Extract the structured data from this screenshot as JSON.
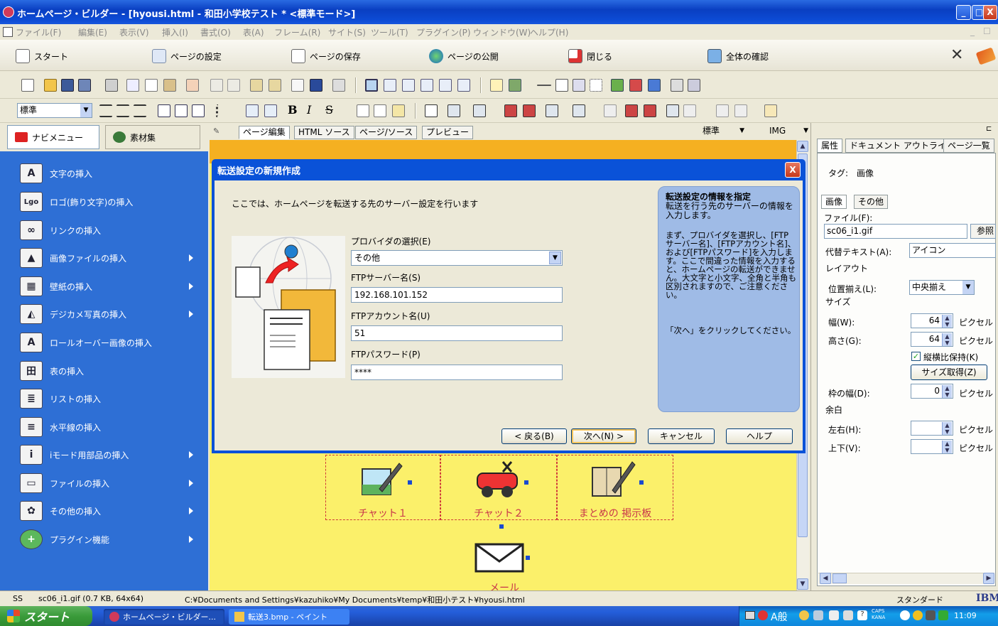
{
  "window": {
    "title": "ホームページ・ビルダー - [hyousi.html - 和田小学校テスト * <標準モード>]",
    "btn_min": "_",
    "btn_max": "□",
    "btn_close": "X"
  },
  "menu": {
    "items": [
      "ファイル(F)",
      "編集(E)",
      "表示(V)",
      "挿入(I)",
      "書式(O)",
      "表(A)",
      "フレーム(R)",
      "サイト(S)",
      "ツール(T)",
      "プラグイン(P)",
      "ウィンドウ(W)",
      "ヘルプ(H)"
    ],
    "mdi_min": "_",
    "mdi_restore": "☐"
  },
  "main_toolbar": {
    "start": "スタート",
    "page_settings": "ページの設定",
    "save_page": "ページの保存",
    "publish_page": "ページの公開",
    "close": "閉じる",
    "check_all": "全体の確認"
  },
  "format_toolbar": {
    "style_value": "標準",
    "bold": "B",
    "italic": "I",
    "strike": "S"
  },
  "nav": {
    "tab_navmenu": "ナビメニュー",
    "tab_materials": "素材集",
    "items": [
      {
        "label": "文字の挿入",
        "icon": "A"
      },
      {
        "label": "ロゴ(飾り文字)の挿入",
        "icon": "Lgo"
      },
      {
        "label": "リンクの挿入",
        "icon": "∞"
      },
      {
        "label": "画像ファイルの挿入",
        "icon": "▲"
      },
      {
        "label": "壁紙の挿入",
        "icon": "▦"
      },
      {
        "label": "デジカメ写真の挿入",
        "icon": "◭"
      },
      {
        "label": "ロールオーバー画像の挿入",
        "icon": "A"
      },
      {
        "label": "表の挿入",
        "icon": "田"
      },
      {
        "label": "リストの挿入",
        "icon": "≣"
      },
      {
        "label": "水平線の挿入",
        "icon": "≡"
      },
      {
        "label": "iモード用部品の挿入",
        "icon": "i"
      },
      {
        "label": "ファイルの挿入",
        "icon": "▭"
      },
      {
        "label": "その他の挿入",
        "icon": "✿"
      },
      {
        "label": "プラグイン機能",
        "icon": "+"
      }
    ]
  },
  "editor": {
    "tabs": [
      "ページ編集",
      "HTML ソース",
      "ページ/ソース",
      "プレビュー"
    ],
    "mode_select": "標準",
    "img_select": "IMG",
    "cells": [
      "チャット１",
      "チャット２",
      "まとめの 掲示板"
    ],
    "mail_label": "メール"
  },
  "dialog": {
    "title": "転送設定の新規作成",
    "close_label": "X",
    "description": "ここでは、ホームページを転送する先のサーバー設定を行います",
    "provider_label": "プロバイダの選択(E)",
    "provider_value": "その他",
    "ftp_server_label": "FTPサーバー名(S)",
    "ftp_server_value": "192.168.101.152",
    "ftp_account_label": "FTPアカウント名(U)",
    "ftp_account_value": "51",
    "ftp_password_label": "FTPパスワード(P)",
    "ftp_password_value": "****",
    "info_heading_1": "転送設定の情報を指定",
    "info_heading_2": "転送を行う先のサーバーの情報を入力します。",
    "info_body": "まず、プロバイダを選択し、[FTPサーバー名]、[FTPアカウント名]、および[FTPパスワード]を入力します。ここで間違った情報を入力すると、ホームページの転送ができません。大文字と小文字、全角と半角も区別されますので、ご注意ください。",
    "info_next": "「次へ」をクリックしてください。",
    "btn_back": "< 戻る(B)",
    "btn_next": "次へ(N) >",
    "btn_cancel": "キャンセル",
    "btn_help": "ヘルプ"
  },
  "props": {
    "tabs": [
      "属性",
      "ドキュメント アウトライナ",
      "ページ一覧"
    ],
    "tag_label": "タグ:",
    "tag_value": "画像",
    "sub_tabs": [
      "画像",
      "その他"
    ],
    "file_label": "ファイル(F):",
    "file_value": "sc06_i1.gif",
    "browse_label": "参照",
    "alt_label": "代替テキスト(A):",
    "alt_value": "アイコン",
    "layout_label": "レイアウト",
    "align_label": "位置揃え(L):",
    "align_value": "中央揃え",
    "size_label": "サイズ",
    "width_label": "幅(W):",
    "width_value": "64",
    "height_label": "高さ(G):",
    "height_value": "64",
    "unit": "ピクセル",
    "keep_ratio_label": "縦横比保持(K)",
    "get_size_label": "サイズ取得(Z)",
    "border_label": "枠の幅(D):",
    "border_value": "0",
    "margin_label": "余白",
    "lr_label": "左右(H):",
    "tb_label": "上下(V):"
  },
  "status": {
    "mode": "SS",
    "file_info": "sc06_i1.gif (0.7 KB, 64x64)",
    "path": "C:¥Documents and Settings¥kazuhiko¥My Documents¥temp¥和田小テスト¥hyousi.html",
    "standard": "スタンダード",
    "ibm": "IBM"
  },
  "taskbar": {
    "start": "スタート",
    "items": [
      "ホームページ・ビルダー...",
      "転送3.bmp - ペイント"
    ],
    "ime": "A般",
    "caps": "CAPS KANA",
    "clock": "11:09"
  },
  "colors": {
    "title_bar": "#0a3fc2",
    "nav_panel": "#2e6fd5",
    "canvas_yellow": "#fbf06a",
    "dialog_frame": "#0a52d8",
    "info_box": "#9fbbe6",
    "taskbar": "#245edb",
    "start_button": "#3a9b3a"
  }
}
